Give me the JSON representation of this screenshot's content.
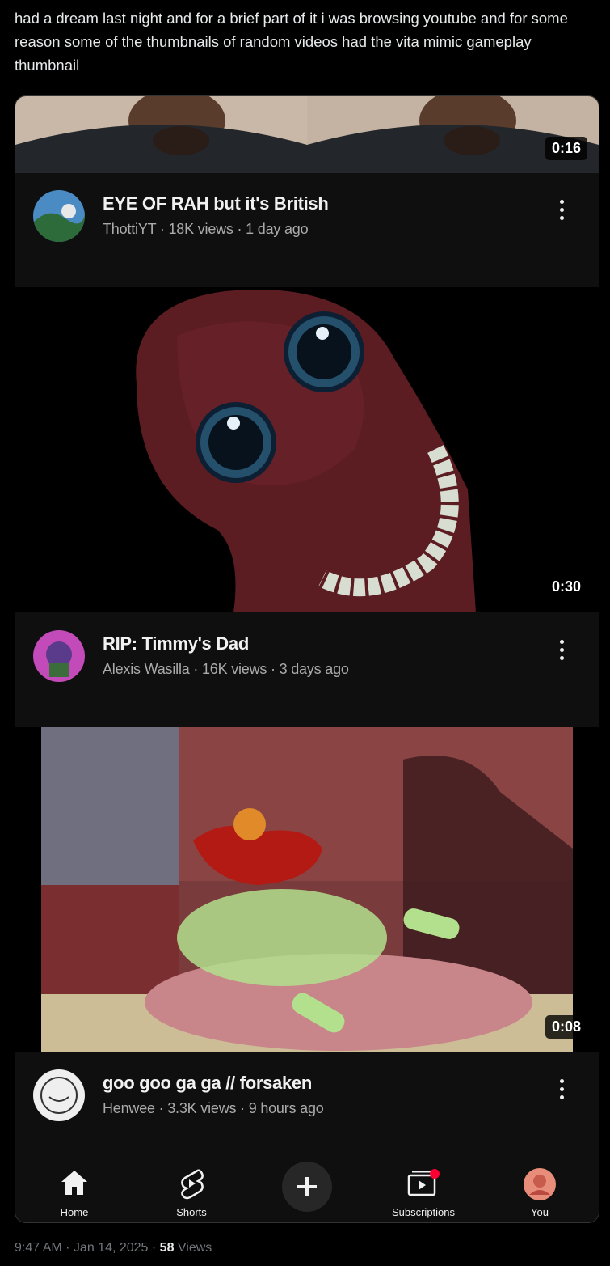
{
  "post": {
    "text": "had a dream last night and for a brief part of it i was browsing youtube and for some reason some of the thumbnails of random videos had the vita mimic gameplay thumbnail"
  },
  "videos": [
    {
      "title": "EYE OF RAH but it's British",
      "channel": "ThottiYT",
      "views": "18K views",
      "age": "1 day ago",
      "duration": "0:16"
    },
    {
      "title": "RIP: Timmy's Dad",
      "channel": "Alexis Wasilla",
      "views": "16K views",
      "age": "3 days ago",
      "duration": "0:30"
    },
    {
      "title": "goo goo ga ga // forsaken",
      "channel": "Henwee",
      "views": "3.3K views",
      "age": "9 hours ago",
      "duration": "0:08"
    }
  ],
  "separator": " · ",
  "nav": {
    "items": [
      {
        "label": "Home",
        "icon": "home-icon"
      },
      {
        "label": "Shorts",
        "icon": "shorts-icon"
      },
      {
        "label": "",
        "icon": "create-plus-icon"
      },
      {
        "label": "Subscriptions",
        "icon": "subscriptions-icon"
      },
      {
        "label": "You",
        "icon": "profile-avatar"
      }
    ]
  },
  "footer": {
    "timestamp": "9:47 AM · Jan 14, 2025 · ",
    "view_count": "58",
    "view_label": " Views"
  },
  "colors": {
    "background": "#000000",
    "card": "#0f0f0f",
    "accent_red": "#ff0033",
    "subtext": "#aaaaaa"
  }
}
